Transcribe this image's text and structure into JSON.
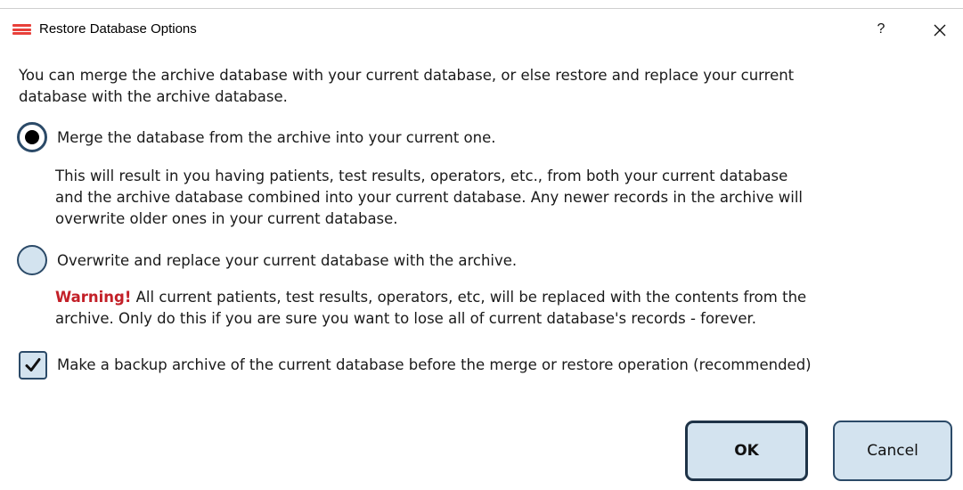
{
  "window": {
    "title": "Restore Database Options",
    "help_label": "?",
    "icon": "app-menu-icon",
    "close_icon": "close-icon"
  },
  "intro": {
    "line1": "You can merge the archive database with your current database, or else restore and replace your current",
    "line2": "database with the archive database."
  },
  "options": {
    "merge": {
      "label": "Merge the database from the archive into your current one.",
      "selected": true,
      "desc_line1": "This will result in you having patients, test results, operators, etc., from both your current database",
      "desc_line2": "and the archive database combined into your current database. Any newer records in the archive will",
      "desc_line3": "overwrite older ones in your current database."
    },
    "overwrite": {
      "label": "Overwrite and replace your current database with the archive.",
      "selected": false,
      "warning_word": "Warning!",
      "desc_line1_rest": " All current patients, test results, operators, etc, will be replaced with the contents from the",
      "desc_line2": "archive. Only do this if you are sure you want to lose all of current database's records - forever."
    }
  },
  "backup": {
    "label": "Make a backup archive of the current database before the merge or restore operation (recommended)",
    "checked": true
  },
  "buttons": {
    "ok": "OK",
    "cancel": "Cancel"
  },
  "colors": {
    "accent_border": "#2b4a68",
    "control_fill": "#d3e3ef",
    "warning": "#c32028",
    "app_icon": "#e8403a"
  }
}
